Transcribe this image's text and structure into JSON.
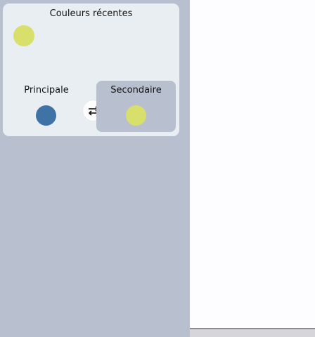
{
  "recent_colors": {
    "title": "Couleurs récentes",
    "swatches": [
      "#d9df6b"
    ]
  },
  "primary": {
    "label": "Principale",
    "color": "#3f72a5"
  },
  "secondary": {
    "label": "Secondaire",
    "color": "#d9df6b",
    "selected": true
  },
  "swap": {
    "icon": "swap-arrows-icon"
  },
  "colors": {
    "sidebar_bg": "#b8bfcf",
    "panel_bg": "#e9eef2",
    "canvas_bg": "#fdfcff"
  }
}
